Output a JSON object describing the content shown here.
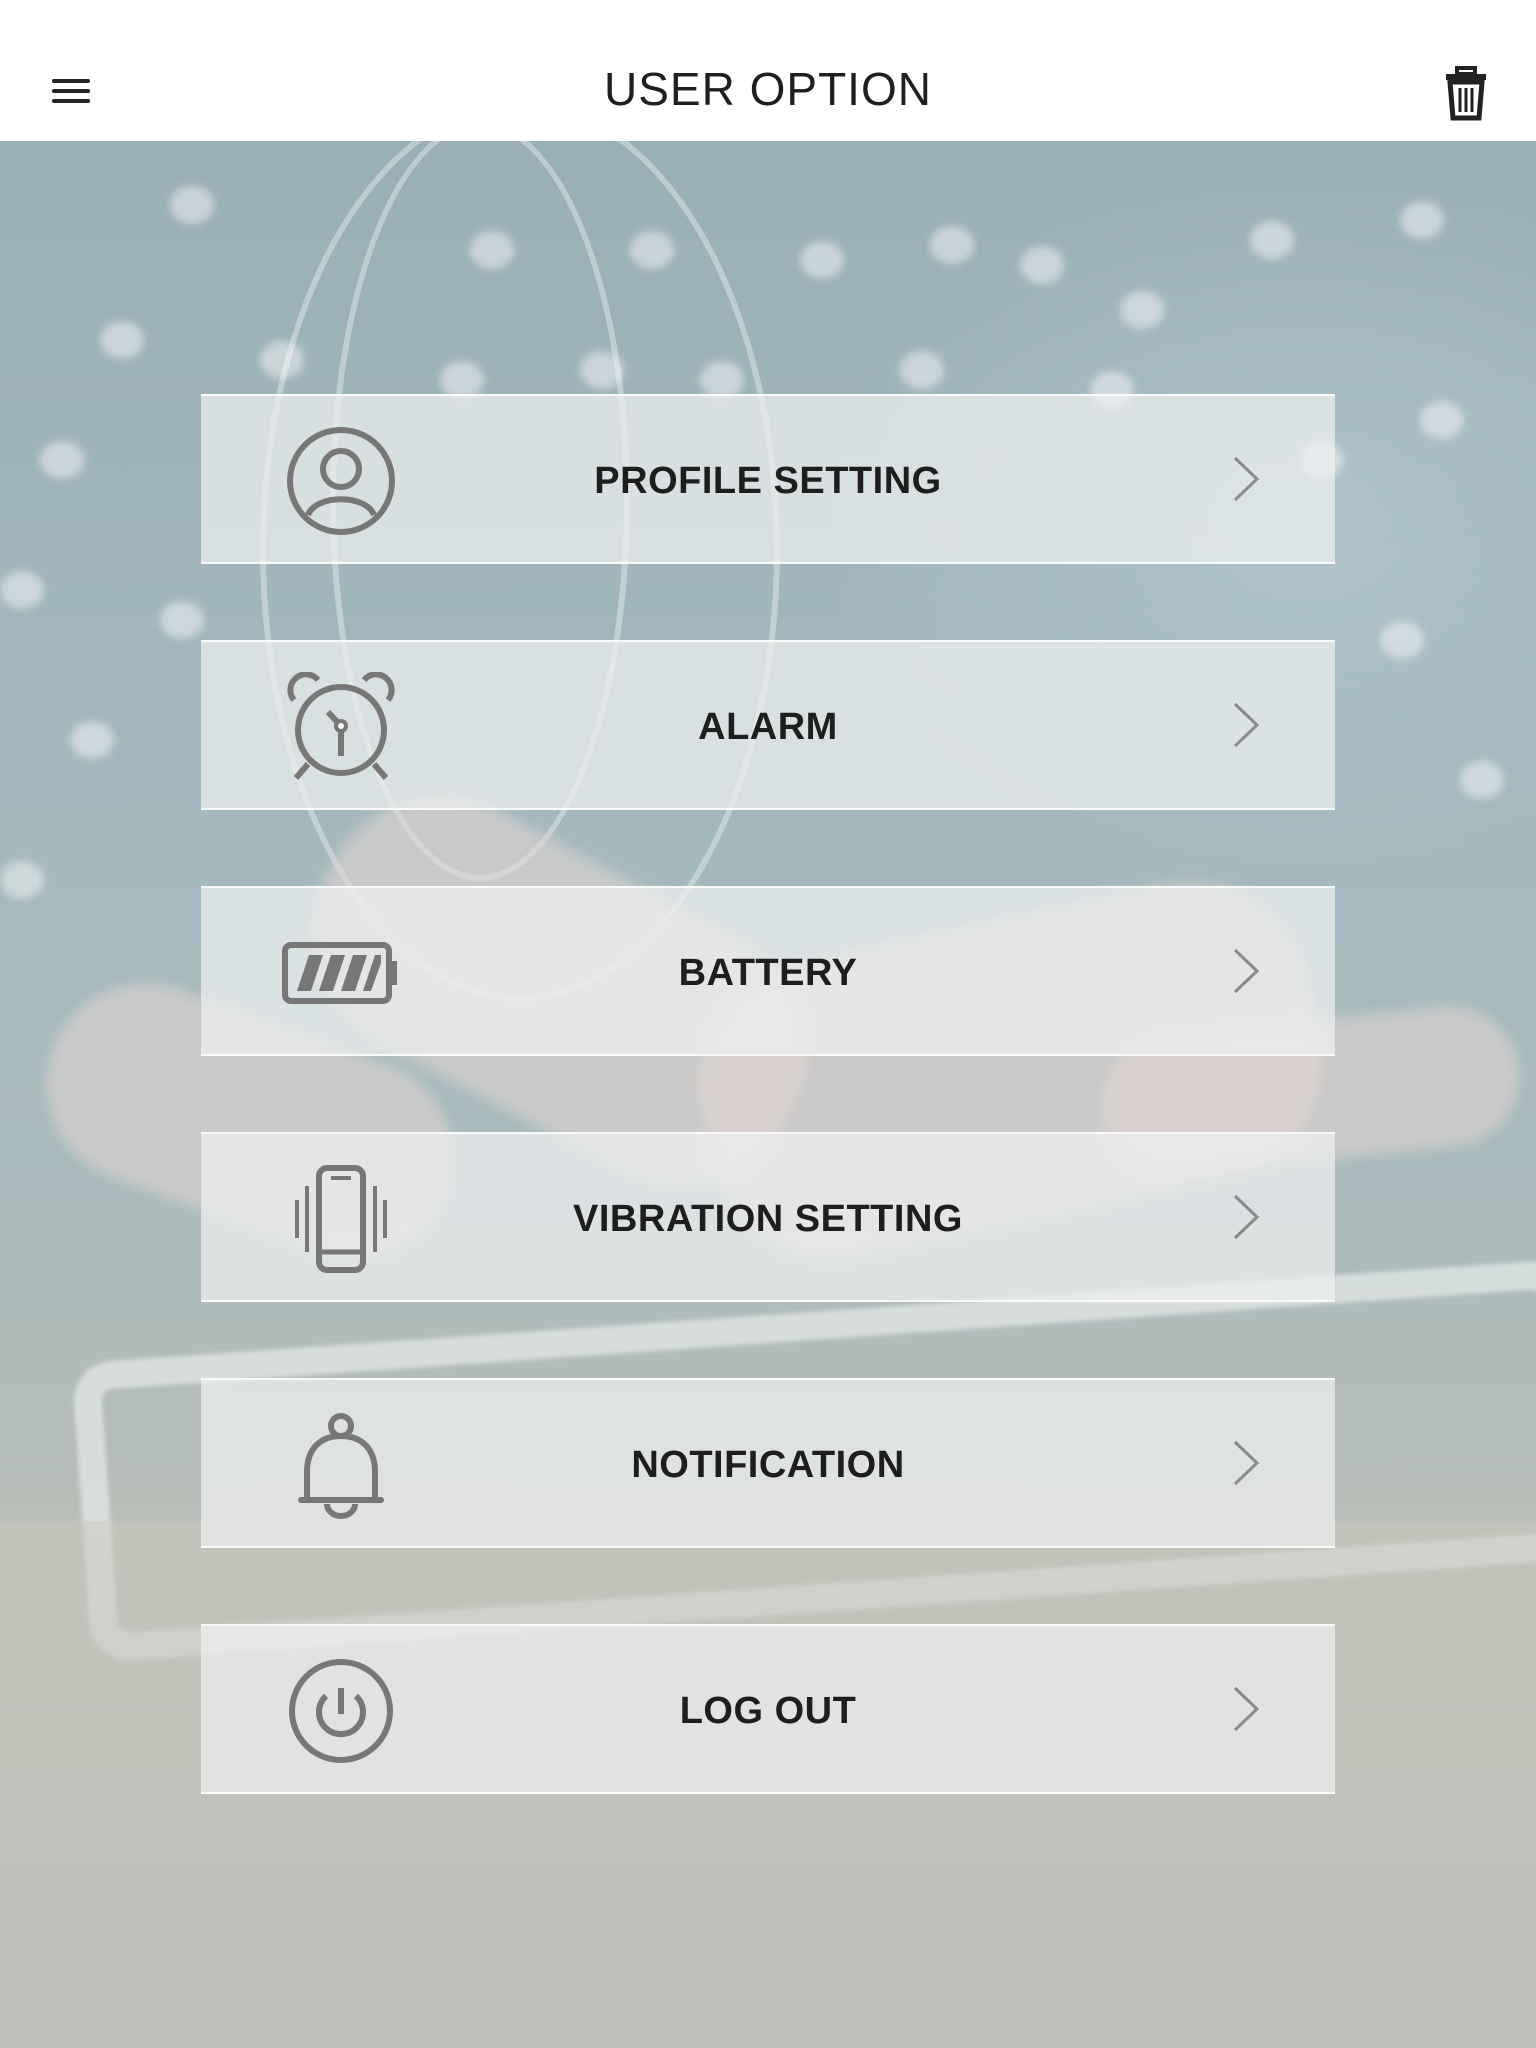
{
  "header": {
    "title": "USER OPTION",
    "menu_icon": "hamburger-menu-icon",
    "trash_icon": "trash-icon"
  },
  "menu": {
    "items": [
      {
        "label": "PROFILE SETTING",
        "icon": "user-profile-icon"
      },
      {
        "label": "ALARM",
        "icon": "alarm-clock-icon"
      },
      {
        "label": "BATTERY",
        "icon": "battery-icon"
      },
      {
        "label": "VIBRATION SETTING",
        "icon": "vibrating-phone-icon"
      },
      {
        "label": "NOTIFICATION",
        "icon": "bell-icon"
      },
      {
        "label": "LOG OUT",
        "icon": "power-icon"
      }
    ]
  },
  "colors": {
    "header_bg": "#ffffff",
    "text": "#1e1e1e",
    "icon": "#777777",
    "item_bg": "rgba(238,240,240,0.72)"
  }
}
